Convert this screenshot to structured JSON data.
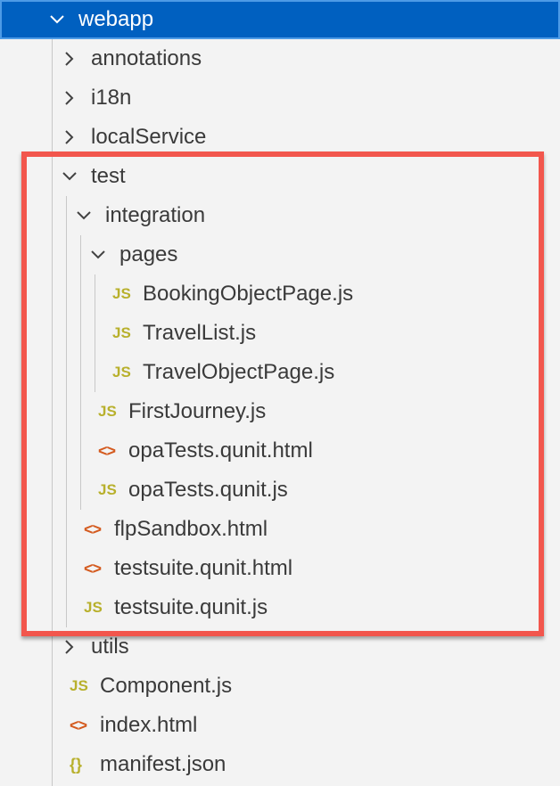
{
  "explorer": {
    "items": [
      {
        "label": "webapp",
        "type": "folder",
        "expanded": true,
        "selected": true,
        "depth": 0
      },
      {
        "label": "annotations",
        "type": "folder",
        "expanded": false,
        "depth": 1
      },
      {
        "label": "i18n",
        "type": "folder",
        "expanded": false,
        "depth": 1
      },
      {
        "label": "localService",
        "type": "folder",
        "expanded": false,
        "depth": 1
      },
      {
        "label": "test",
        "type": "folder",
        "expanded": true,
        "depth": 1
      },
      {
        "label": "integration",
        "type": "folder",
        "expanded": true,
        "depth": 2
      },
      {
        "label": "pages",
        "type": "folder",
        "expanded": true,
        "depth": 3
      },
      {
        "label": "BookingObjectPage.js",
        "type": "js",
        "icon": "JS",
        "depth": 4
      },
      {
        "label": "TravelList.js",
        "type": "js",
        "icon": "JS",
        "depth": 4
      },
      {
        "label": "TravelObjectPage.js",
        "type": "js",
        "icon": "JS",
        "depth": 4
      },
      {
        "label": "FirstJourney.js",
        "type": "js",
        "icon": "JS",
        "depth": 3
      },
      {
        "label": "opaTests.qunit.html",
        "type": "html",
        "icon": "<>",
        "depth": 3
      },
      {
        "label": "opaTests.qunit.js",
        "type": "js",
        "icon": "JS",
        "depth": 3
      },
      {
        "label": "flpSandbox.html",
        "type": "html",
        "icon": "<>",
        "depth": 2
      },
      {
        "label": "testsuite.qunit.html",
        "type": "html",
        "icon": "<>",
        "depth": 2
      },
      {
        "label": "testsuite.qunit.js",
        "type": "js",
        "icon": "JS",
        "depth": 2
      },
      {
        "label": "utils",
        "type": "folder",
        "expanded": false,
        "depth": 1
      },
      {
        "label": "Component.js",
        "type": "js",
        "icon": "JS",
        "depth": 1
      },
      {
        "label": "index.html",
        "type": "html",
        "icon": "<>",
        "depth": 1
      },
      {
        "label": "manifest.json",
        "type": "json",
        "icon": "{}",
        "depth": 1
      }
    ]
  },
  "colors": {
    "selection": "#0060c0",
    "highlight_border": "#f2564d",
    "js_icon": "#b8b02c",
    "html_icon": "#d45a1e"
  }
}
